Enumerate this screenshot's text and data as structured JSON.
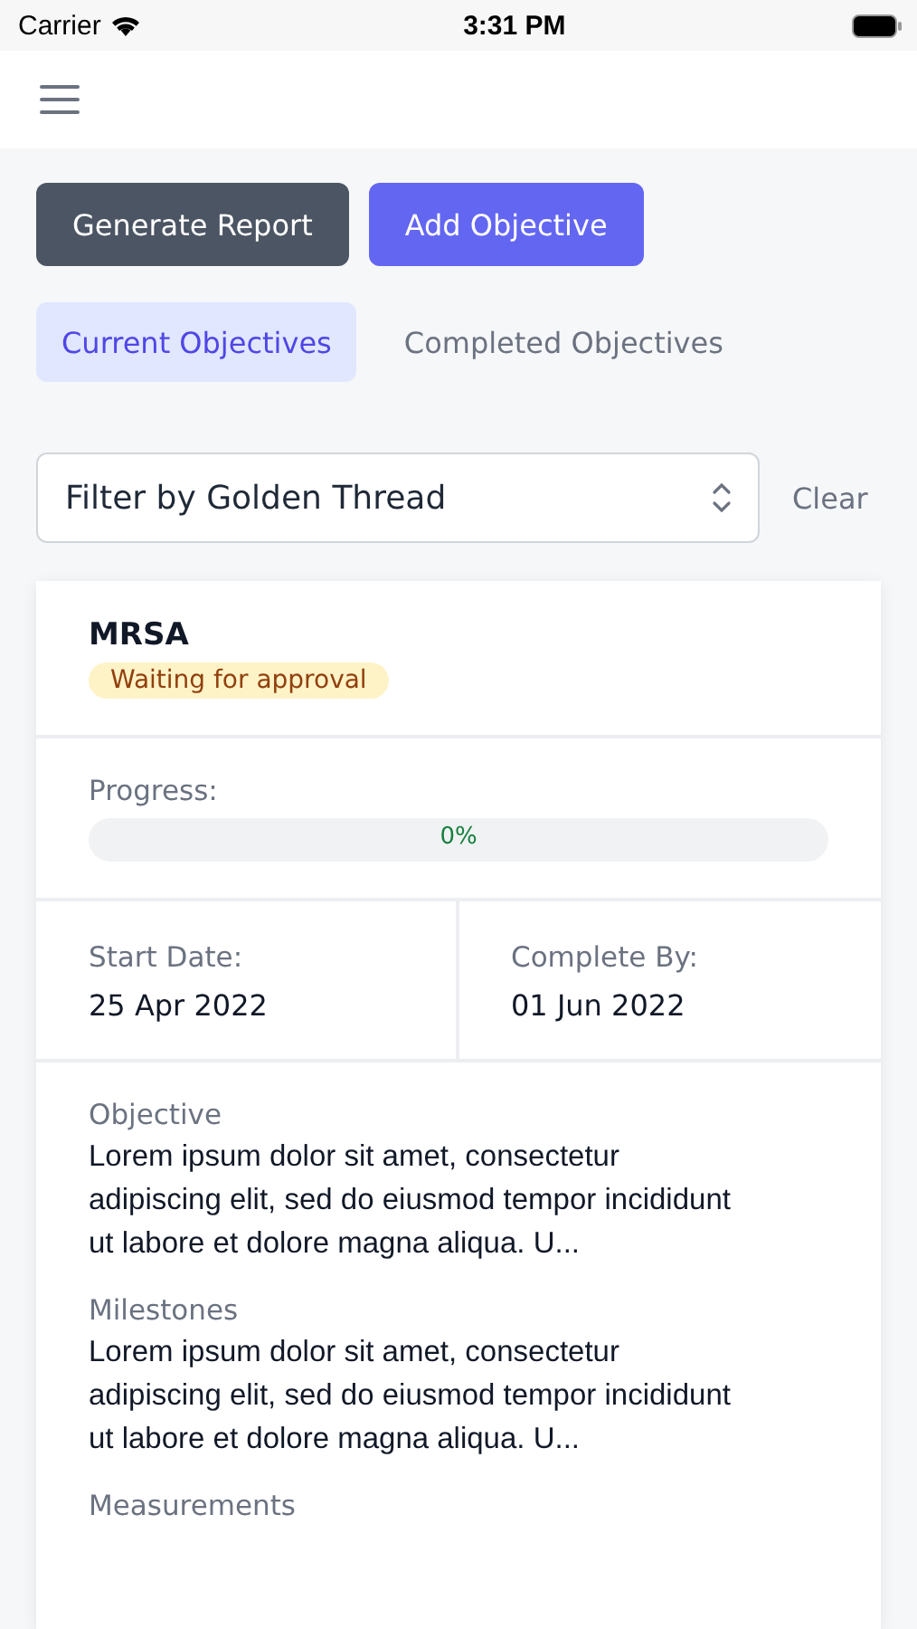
{
  "status_bar": {
    "carrier": "Carrier",
    "time": "3:31 PM"
  },
  "actions": [
    {
      "label": "Generate Report",
      "kind": "dark"
    },
    {
      "label": "Add Objective",
      "kind": "primary"
    }
  ],
  "tabs": [
    {
      "label": "Current Objectives",
      "selected": true
    },
    {
      "label": "Completed Objectives",
      "selected": false
    }
  ],
  "filter": {
    "placeholder": "Filter by Golden Thread",
    "clear": "Clear"
  },
  "card": {
    "title": "MRSA",
    "status": "Waiting for approval",
    "progress_label": "Progress:",
    "progress": {
      "level": 0,
      "reading": "0%"
    },
    "dates": [
      {
        "label": "Start Date:",
        "value": "25 Apr 2022"
      },
      {
        "label": "Complete By:",
        "value": "01 Jun 2022"
      }
    ],
    "sections": [
      {
        "label": "Objective",
        "text": "Lorem ipsum dolor sit amet, consectetur adipiscing elit, sed do eiusmod tempor incididunt ut labore et dolore magna aliqua. U..."
      },
      {
        "label": "Milestones",
        "text": "Lorem ipsum dolor sit amet, consectetur adipiscing elit, sed do eiusmod tempor incididunt ut labore et dolore magna aliqua. U..."
      },
      {
        "label": "Measurements"
      }
    ]
  }
}
